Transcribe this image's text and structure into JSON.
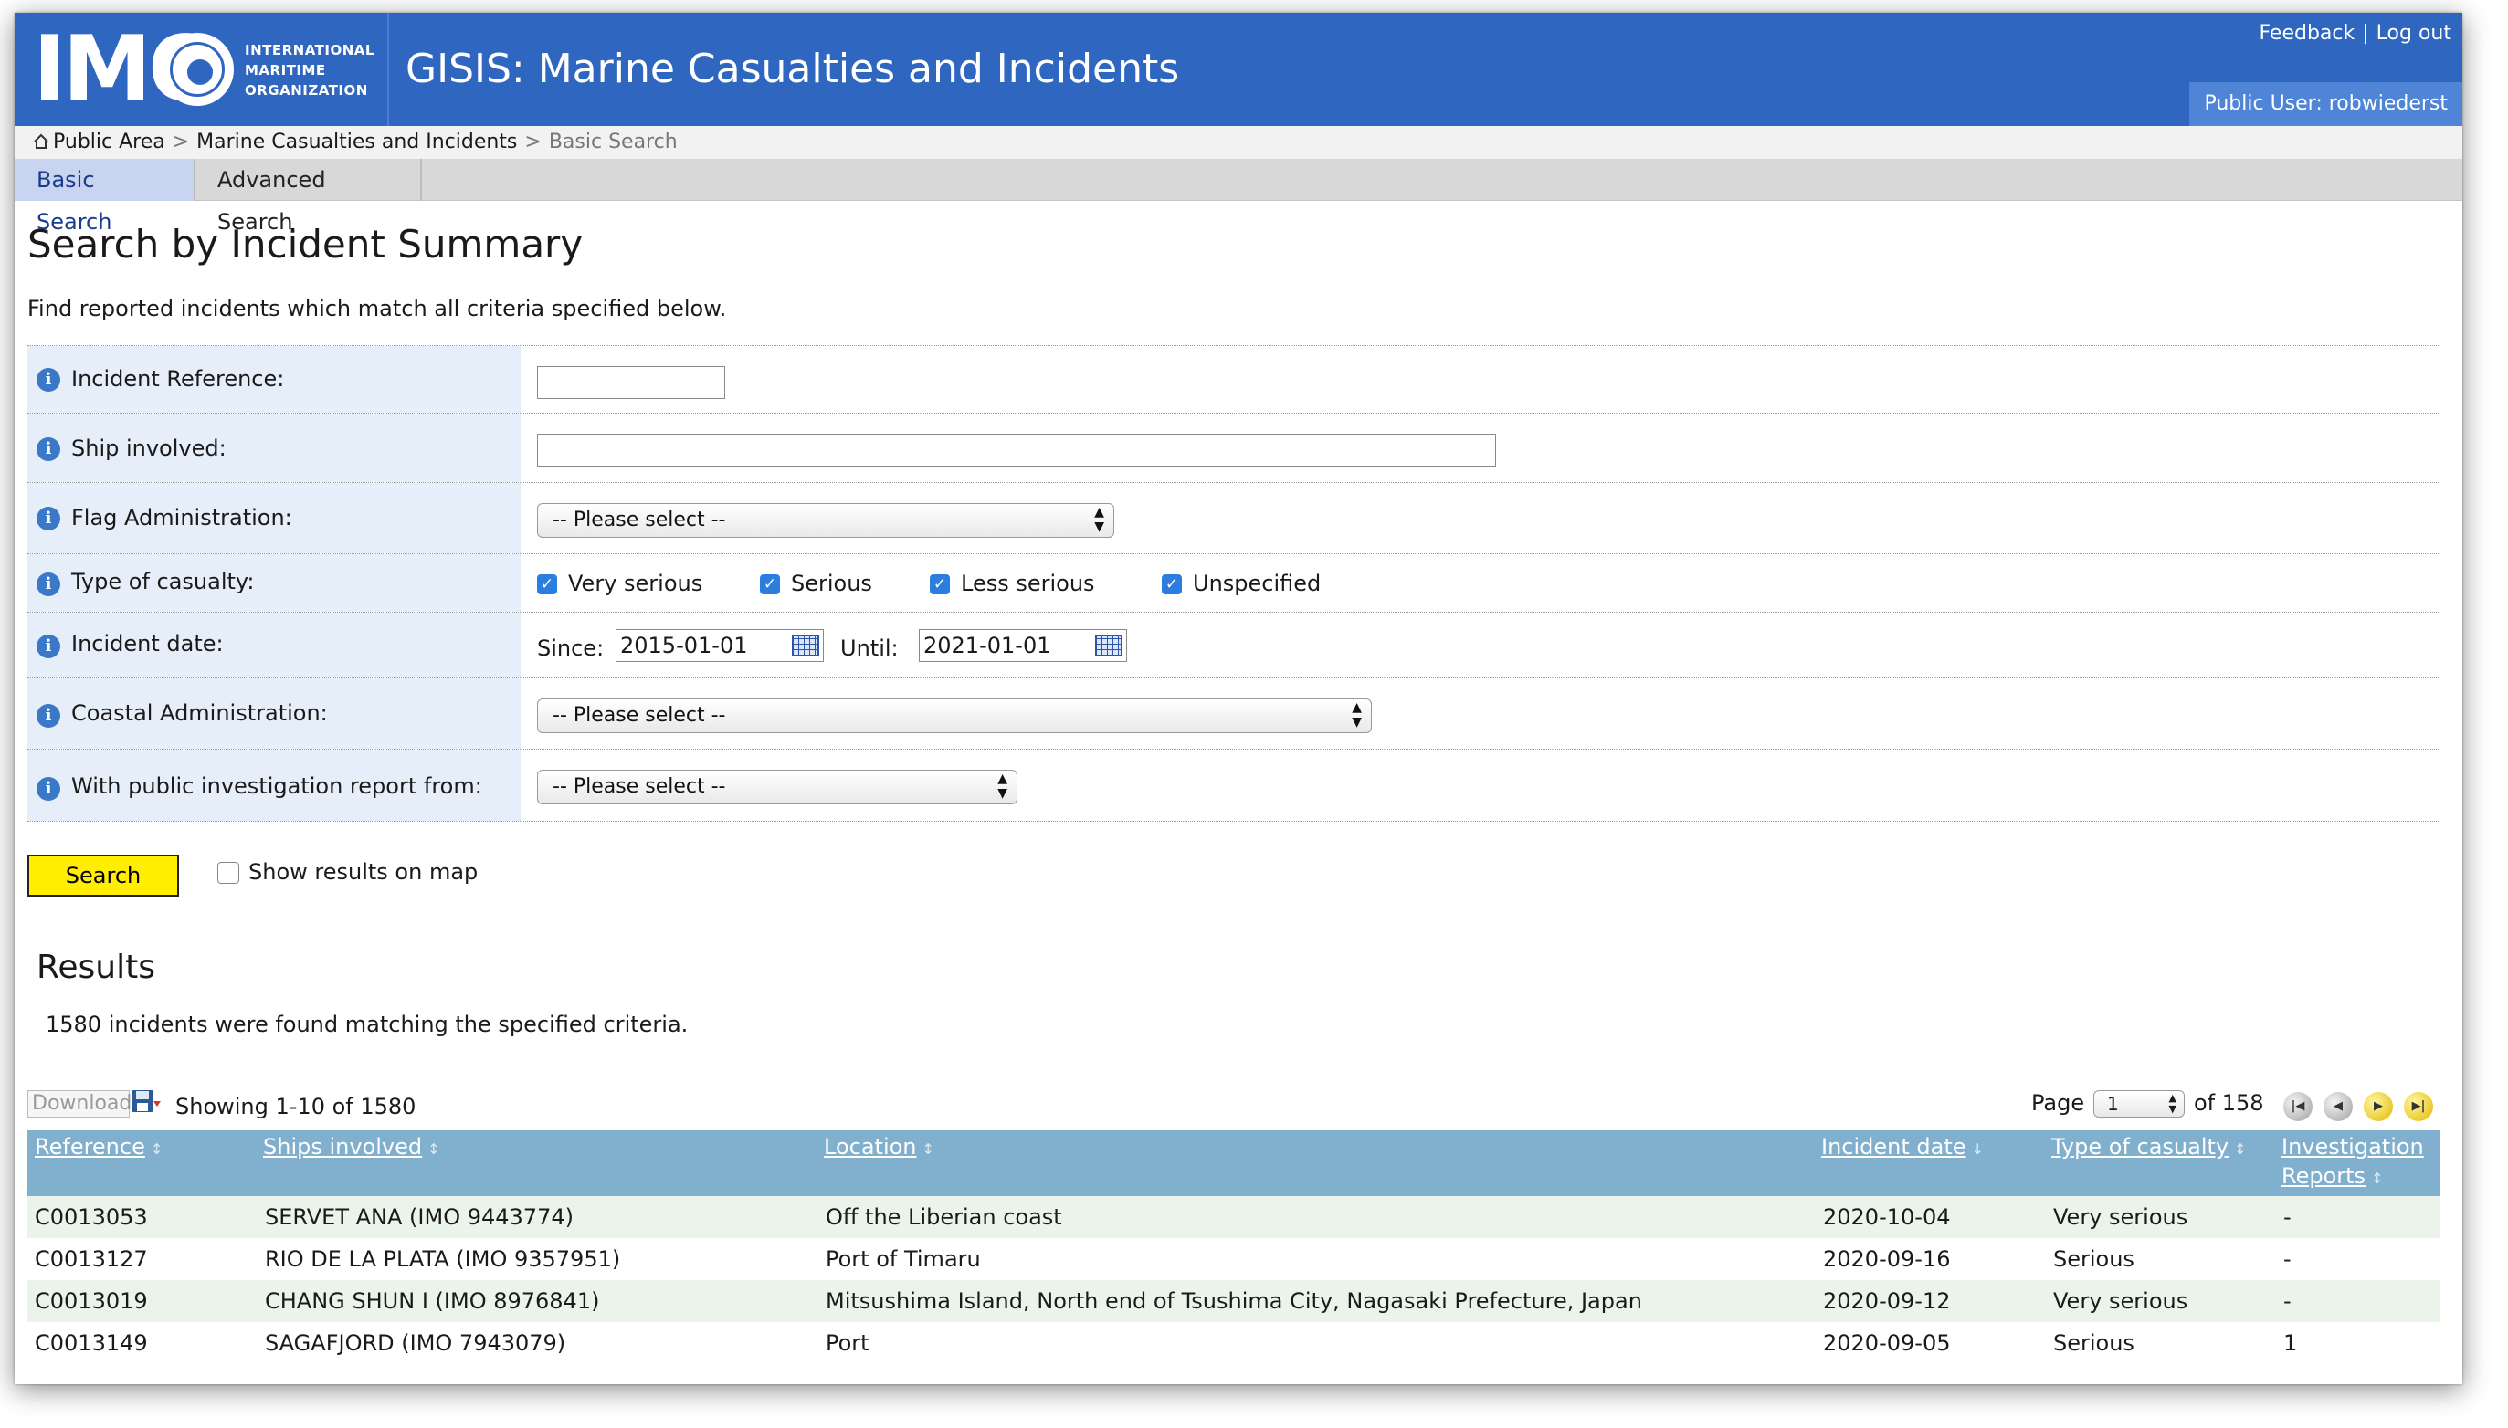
{
  "header": {
    "logo_text": "IMO",
    "logo_org": [
      "INTERNATIONAL",
      "MARITIME",
      "ORGANIZATION"
    ],
    "app_title": "GISIS: Marine Casualties and Incidents",
    "feedback_label": "Feedback",
    "logout_label": "Log out",
    "link_separator": "|",
    "user_label": "Public User: robwiederst",
    "color": "#2f66c0"
  },
  "breadcrumb": {
    "items": [
      "Public Area",
      "Marine Casualties and Incidents",
      "Basic Search"
    ],
    "separator": ">"
  },
  "tabs": [
    {
      "label": "Basic Search",
      "active": true
    },
    {
      "label": "Advanced Search",
      "active": false
    }
  ],
  "form": {
    "title": "Search by Incident Summary",
    "intro": "Find reported incidents which match all criteria specified below.",
    "fields": {
      "incident_reference": {
        "label": "Incident Reference:",
        "value": ""
      },
      "ship_involved": {
        "label": "Ship involved:",
        "value": ""
      },
      "flag_administration": {
        "label": "Flag Administration:",
        "selected": "-- Please select --"
      },
      "type_of_casualty": {
        "label": "Type of casualty:",
        "options": [
          {
            "label": "Very serious",
            "checked": true
          },
          {
            "label": "Serious",
            "checked": true
          },
          {
            "label": "Less serious",
            "checked": true
          },
          {
            "label": "Unspecified",
            "checked": true
          }
        ]
      },
      "incident_date": {
        "label": "Incident date:",
        "since_label": "Since:",
        "since": "2015-01-01",
        "until_label": "Until:",
        "until": "2021-01-01"
      },
      "coastal_administration": {
        "label": "Coastal Administration:",
        "selected": "-- Please select --"
      },
      "public_report": {
        "label": "With public investigation report from:",
        "selected": "-- Please select --"
      }
    },
    "search_label": "Search",
    "show_on_map_label": "Show results on map",
    "show_on_map_checked": false
  },
  "results": {
    "title": "Results",
    "summary": "1580 incidents were found matching the specified criteria.",
    "download_label": "Download",
    "showing": "Showing 1-10 of 1580",
    "page_label": "Page",
    "page_value": "1",
    "page_of": "of 158",
    "columns": [
      {
        "label": "Reference",
        "sort": "↕"
      },
      {
        "label": "Ships involved",
        "sort": "↕"
      },
      {
        "label": "Location",
        "sort": "↕"
      },
      {
        "label": "Incident date",
        "sort": "↓"
      },
      {
        "label": "Type of casualty",
        "sort": "↕"
      },
      {
        "label": "Investigation",
        "label2": "Reports",
        "sort": "↕"
      }
    ],
    "rows": [
      {
        "reference": "C0013053",
        "ships": "SERVET ANA (IMO 9443774)",
        "location": "Off the Liberian coast",
        "date": "2020-10-04",
        "type": "Very serious",
        "reports": "-"
      },
      {
        "reference": "C0013127",
        "ships": "RIO DE LA PLATA (IMO 9357951)",
        "location": "Port of Timaru",
        "date": "2020-09-16",
        "type": "Serious",
        "reports": "-"
      },
      {
        "reference": "C0013019",
        "ships": "CHANG SHUN I (IMO 8976841)",
        "location": "Mitsushima Island, North end of Tsushima City, Nagasaki Prefecture, Japan",
        "date": "2020-09-12",
        "type": "Very serious",
        "reports": "-"
      },
      {
        "reference": "C0013149",
        "ships": "SAGAFJORD (IMO 7943079)",
        "location": "Port",
        "date": "2020-09-05",
        "type": "Serious",
        "reports": "1"
      }
    ]
  },
  "icons": {
    "info": "i",
    "checkbox_checked": "✓",
    "nav_first": "|◀",
    "nav_prev": "◀",
    "nav_next": "▶",
    "nav_last": "▶|",
    "select_arrow_up": "▲",
    "select_arrow_down": "▼"
  }
}
